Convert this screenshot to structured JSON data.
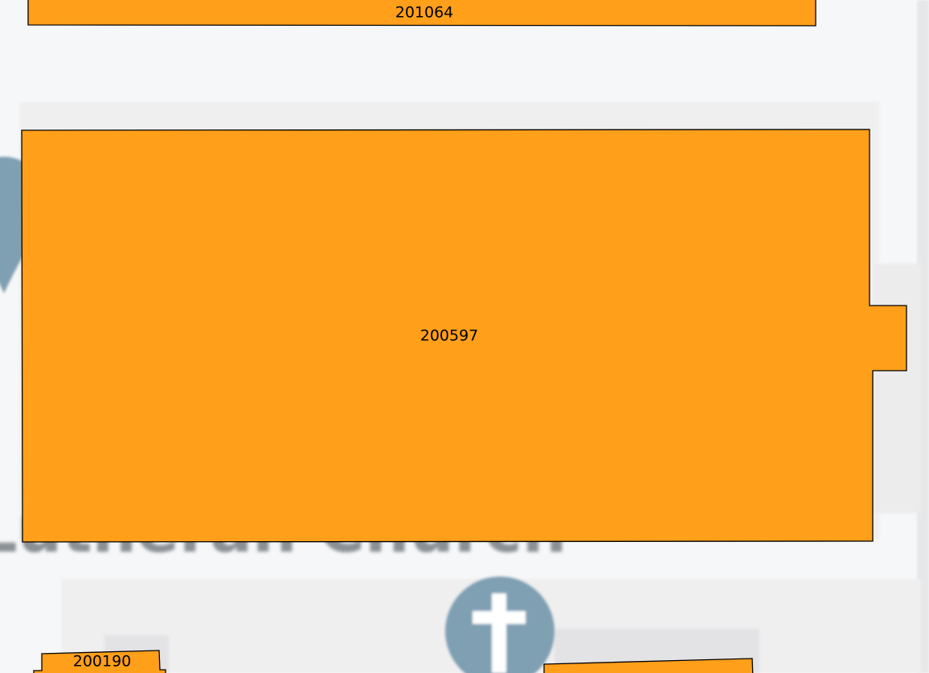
{
  "map": {
    "basemap_label": "Lutheran Church",
    "basemap_icons": [
      "map-pin-icon",
      "church-cross-icon"
    ],
    "colors": {
      "background": "#f6f7f8",
      "building": "#efefef",
      "icon": "#7f9fb2",
      "parcel_fill": "#ff9f1a",
      "parcel_stroke": "#000000"
    },
    "parcels": [
      {
        "id": "201064",
        "label": "201064"
      },
      {
        "id": "200597",
        "label": "200597"
      },
      {
        "id": "200190",
        "label": "200190"
      },
      {
        "id": "parcel-bottom-right",
        "label": ""
      }
    ]
  }
}
